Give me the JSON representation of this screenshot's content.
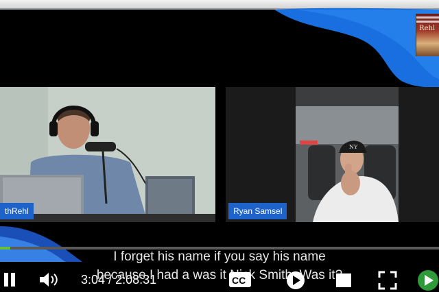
{
  "participants": {
    "left": {
      "name": "thRehl"
    },
    "right": {
      "name": "Ryan Samsel"
    }
  },
  "logo": {
    "text": "Rehl"
  },
  "player": {
    "progress_fraction": 0.024,
    "current_time": "3:04",
    "separator": " / ",
    "duration": "2:08:31",
    "cc_label": "CC"
  },
  "subtitles": {
    "line1": "I forget his name if you say his name",
    "line2": "because I had a was it Nick Smith. Was it?"
  },
  "colors": {
    "accent_blue": "#1e63c9",
    "progress_green": "#66c23a",
    "swoosh_blue": "#1a6fe0"
  },
  "icons": {
    "pause": "pause-icon",
    "volume": "volume-icon",
    "captions": "captions-icon",
    "play": "play-icon",
    "fullscreen": "fullscreen-icon",
    "next": "next-icon"
  }
}
